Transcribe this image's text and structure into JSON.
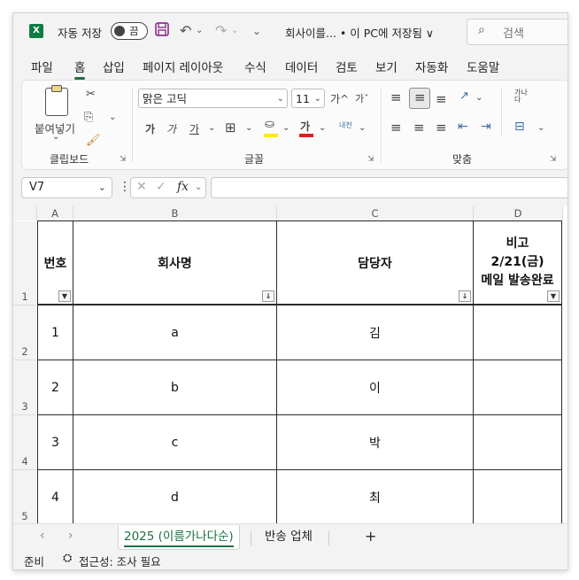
{
  "titlebar": {
    "app_icon": "excel-logo",
    "app_icon_letter": "X",
    "autosave_label": "자동 저장",
    "autosave_state": "끔",
    "doc_title": "회사이를... • 이 PC에 저장됨 ∨",
    "search_placeholder": "검색"
  },
  "tabs": [
    "파일",
    "홈",
    "삽입",
    "페이지 레이아웃",
    "수식",
    "데이터",
    "검토",
    "보기",
    "자동화",
    "도움말"
  ],
  "active_tab": "홈",
  "ribbon": {
    "clipboard": {
      "paste_label": "붙여넣기",
      "group_label": "클립보드"
    },
    "font": {
      "font_name": "맑은 고딕",
      "font_size": "11",
      "grow_label": "가^",
      "shrink_label": "가ˇ",
      "bold_label": "가",
      "italic_label": "가",
      "underline_label": "가",
      "fontcolor_label": "가",
      "phonetic_label": "내천",
      "group_label": "글꼴"
    },
    "alignment": {
      "wrap_label": "가나 다",
      "group_label": "맞춤"
    }
  },
  "formula_bar": {
    "name_box": "V7",
    "fx_label": "fx",
    "formula": ""
  },
  "columns": [
    "A",
    "B",
    "C",
    "D"
  ],
  "header_row": {
    "row_number": "1",
    "cells": [
      "번호",
      "회사명",
      "담당자",
      "비고\n2/21(금)\n메일 발송완료"
    ]
  },
  "rows": [
    {
      "row_number": "2",
      "cells": [
        "1",
        "a",
        "김",
        ""
      ]
    },
    {
      "row_number": "3",
      "cells": [
        "2",
        "b",
        "이",
        ""
      ]
    },
    {
      "row_number": "4",
      "cells": [
        "3",
        "c",
        "박",
        ""
      ]
    },
    {
      "row_number": "5",
      "cells": [
        "4",
        "d",
        "최",
        ""
      ]
    }
  ],
  "sheets": [
    {
      "name": "2025 (이름가나다순)",
      "active": true
    },
    {
      "name": "반송 업체",
      "active": false
    }
  ],
  "add_sheet_label": "+",
  "status": {
    "ready": "준비",
    "accessibility": "접근성: 조사 필요"
  }
}
